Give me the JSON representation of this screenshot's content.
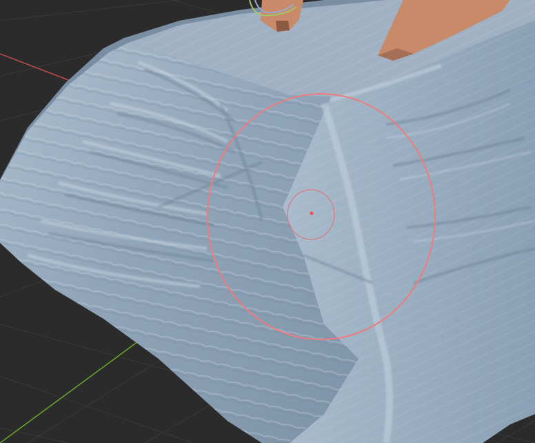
{
  "viewport": {
    "background_color": "#2b2b2b",
    "grid_color": "#3a3a3a",
    "x_axis_color": "#c24a4a",
    "y_axis_color": "#6aa82c"
  },
  "mesh": {
    "base_color": "#8fa3b6",
    "shadow_color": "#6b7f93",
    "highlight_color": "#b9c9d8"
  },
  "props": {
    "wood_color": "#c98a6a",
    "wood_dark_color": "#8a5a42",
    "handle_outline_color": "#a6c36a"
  },
  "brush": {
    "outer_ring_color": "#f07b7b",
    "inner_ring_color": "#e66b6b",
    "center_dot_color": "#ff4a4a"
  }
}
